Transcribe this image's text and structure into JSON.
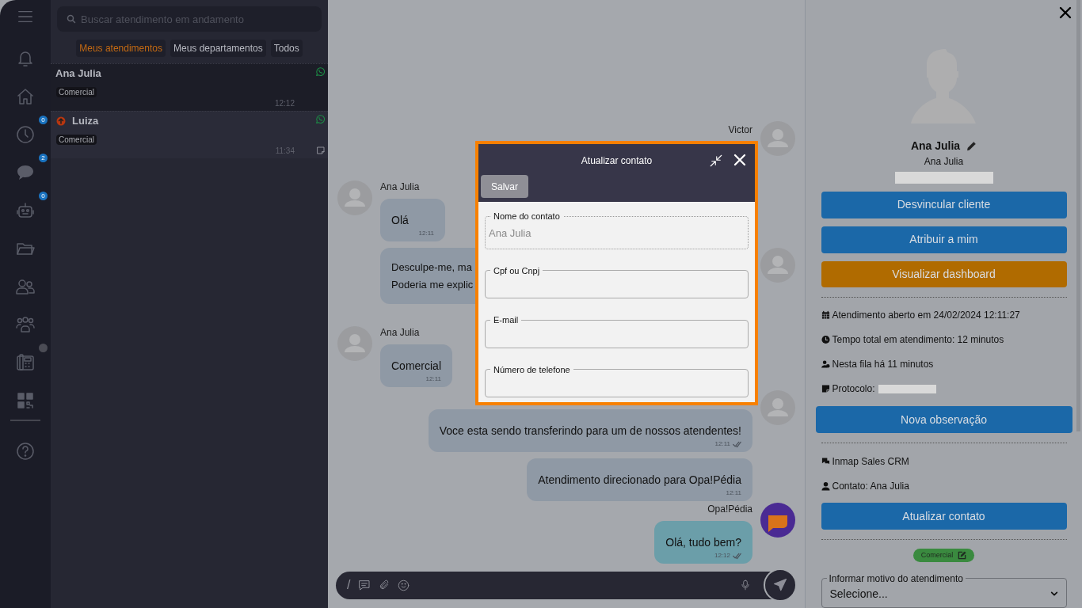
{
  "nav": {
    "items": [
      {
        "kind": "bell",
        "dot": false
      },
      {
        "kind": "home",
        "dot": false
      },
      {
        "kind": "clock",
        "badge": "0",
        "dot": false
      },
      {
        "kind": "chat",
        "badge": "2",
        "dot": false
      },
      {
        "kind": "robot",
        "badge": "0",
        "dot": false
      },
      {
        "kind": "folder",
        "dot": false
      },
      {
        "kind": "users",
        "dot": false
      },
      {
        "kind": "team",
        "dot": false
      },
      {
        "kind": "phone",
        "dot": true
      },
      {
        "kind": "qr",
        "dot": false
      },
      {
        "kind": "help",
        "dot": false
      }
    ]
  },
  "conversations": {
    "search": {
      "placeholder": "Buscar atendimento em andamento"
    },
    "filters": [
      {
        "label": "Meus atendimentos",
        "selected": true
      },
      {
        "label": "Meus departamentos",
        "selected": false
      },
      {
        "label": "Todos",
        "selected": false
      }
    ],
    "items": [
      {
        "name": "Ana Julia",
        "tag": "Comercial",
        "time": "12:12",
        "selected": true,
        "transferred": false,
        "note": false
      },
      {
        "name": "Luiza",
        "tag": "Comercial",
        "time": "11:34",
        "selected": false,
        "transferred": true,
        "note": true
      }
    ]
  },
  "chat": {
    "rows": [
      {
        "right": {
          "kind": "sender",
          "name": "Victor",
          "avatar": {
            "kind": "person"
          }
        }
      },
      {
        "left": {
          "kind": "message",
          "sender": "Ana Julia",
          "avatar": {
            "kind": "person"
          },
          "lines": [
            "Olá"
          ],
          "time": "12:11",
          "ticks": false,
          "color": "#8f99a5"
        }
      },
      {
        "left": {
          "kind": "message",
          "lines": [
            "Desculpe-me, ma",
            "Poderia me explic"
          ],
          "color": "#8f99a5",
          "ticks": false
        },
        "right": {
          "kind": "avatar",
          "avatar": {
            "kind": "person"
          }
        }
      },
      {
        "left": {
          "kind": "message",
          "sender": "Ana Julia",
          "avatar": {
            "kind": "person"
          },
          "lines": [
            "Comercial"
          ],
          "time": "12:11",
          "ticks": false,
          "color": "#8f99a5"
        }
      },
      {
        "right": {
          "kind": "message",
          "avatar": {
            "kind": "person"
          },
          "lines": [
            "Voce esta sendo transferindo para um de nossos atendentes!"
          ],
          "time": "12:11",
          "ticks": true,
          "color": "#8f99a5"
        }
      },
      {
        "right": {
          "kind": "message",
          "lines": [
            "Atendimento direcionado para Opa!Pédia"
          ],
          "time": "12:11",
          "ticks": false,
          "color": "#8f99a5"
        }
      },
      {
        "right": {
          "kind": "message",
          "sender": "Opa!Pédia",
          "avatar": {
            "kind": "logo"
          },
          "lines": [
            "Olá, tudo bem?"
          ],
          "time": "12:12",
          "ticks": true,
          "color": "#6b9ea9"
        }
      }
    ],
    "composer": {
      "slash": "/"
    }
  },
  "modal": {
    "title": "Atualizar contato",
    "save": "Salvar",
    "fields": [
      {
        "label": "Nome do contato",
        "value": "Ana Julia",
        "disabled": true
      },
      {
        "label": "Cpf ou Cnpj",
        "disabled": false
      },
      {
        "label": "E-mail",
        "disabled": false
      },
      {
        "label": "Número de telefone",
        "disabled": false
      }
    ]
  },
  "panel": {
    "name": "Ana Julia",
    "subtitle": "Ana Julia",
    "buttons": [
      {
        "label": "Desvincular cliente",
        "color": "#1b68a8"
      },
      {
        "label": "Atribuir a mim",
        "color": "#1b68a8"
      },
      {
        "label": "Visualizar dashboard",
        "color": "#b06b00"
      }
    ],
    "info": [
      {
        "kind": "calendar",
        "text": "Atendimento aberto em 24/02/2024 12:11:27",
        "redacted": false
      },
      {
        "kind": "clock",
        "text": "Tempo total em atendimento: 12 minutos",
        "redacted": false
      },
      {
        "kind": "queue",
        "text": "Nesta fila há 11 minutos",
        "redacted": false
      },
      {
        "kind": "note",
        "text": "Protocolo:",
        "redacted": true
      }
    ],
    "note_button": "Nova observação",
    "crm": [
      {
        "kind": "crm",
        "text": "Inmap Sales CRM"
      },
      {
        "kind": "user",
        "text": "Contato: Ana Julia"
      }
    ],
    "update_button": "Atualizar contato",
    "tag": "Comercial",
    "reason": {
      "label": "Informar motivo do atendimento",
      "value": "Selecione..."
    }
  }
}
